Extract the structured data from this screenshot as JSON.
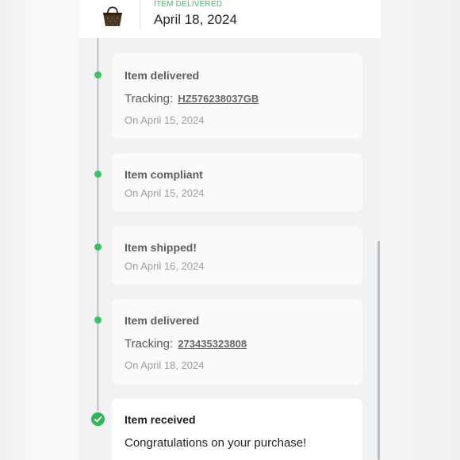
{
  "header": {
    "status_label": "ITEM DELIVERED",
    "status_date": "April 18, 2024"
  },
  "timeline": [
    {
      "title": "Item delivered",
      "tracking_prefix": "Tracking:",
      "tracking_number": "HZ576238037GB",
      "date": "On April 15, 2024"
    },
    {
      "title": "Item compliant",
      "date": "On April 15, 2024"
    },
    {
      "title": "Item shipped!",
      "date": "On April 16, 2024"
    },
    {
      "title": "Item delivered",
      "tracking_prefix": "Tracking:",
      "tracking_number": "273435323808",
      "date": "On April 18, 2024"
    },
    {
      "title": "Item received",
      "message": "Congratulations on your purchase!"
    }
  ],
  "colors": {
    "accent_green": "#3dbf63",
    "panel_bg": "#f1f2f3",
    "card_bg": "#fafafa"
  },
  "icons": {
    "product": "handbag-icon",
    "completed": "check-circle-icon",
    "step": "timeline-dot-icon"
  }
}
